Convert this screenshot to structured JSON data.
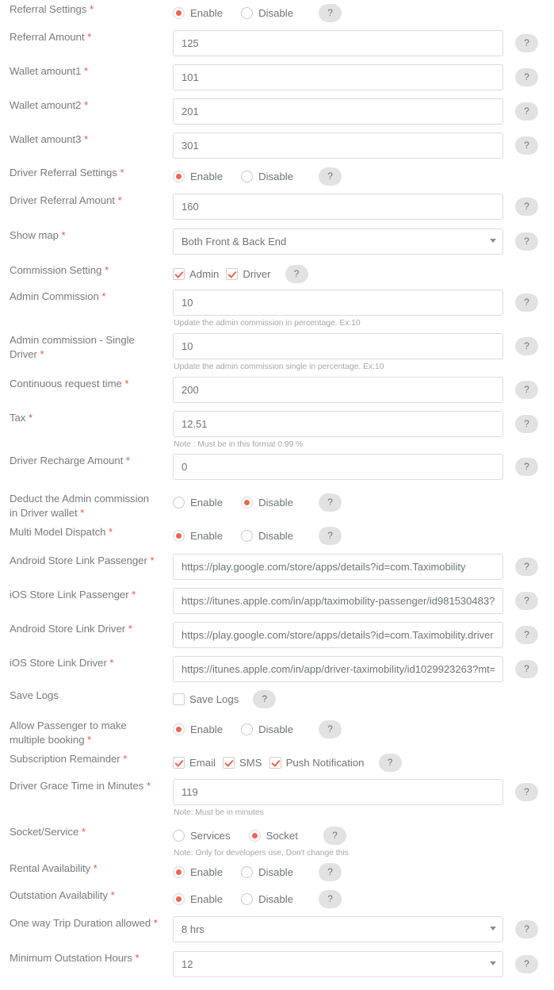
{
  "help_label": "?",
  "colors": {
    "accent": "#f4634e",
    "required": "#e8554d",
    "label_text": "#7b7b7b",
    "input_text": "#6e7478",
    "note_text": "#a8a8a8",
    "help_bg": "#e2e2e2",
    "border": "#dcdcdc"
  },
  "options": {
    "enable": "Enable",
    "disable": "Disable",
    "services": "Services",
    "socket": "Socket"
  },
  "rows": [
    {
      "id": "referral-settings",
      "label": "Referral Settings",
      "required": true,
      "type": "radio",
      "options": [
        "Enable",
        "Disable"
      ],
      "selected": "Enable"
    },
    {
      "id": "referral-amount",
      "label": "Referral Amount",
      "required": true,
      "type": "text",
      "value": "125"
    },
    {
      "id": "wallet-amount1",
      "label": "Wallet amount1",
      "required": true,
      "type": "text",
      "value": "101"
    },
    {
      "id": "wallet-amount2",
      "label": "Wallet amount2",
      "required": true,
      "type": "text",
      "value": "201"
    },
    {
      "id": "wallet-amount3",
      "label": "Wallet amount3",
      "required": true,
      "type": "text",
      "value": "301"
    },
    {
      "id": "driver-referral-settings",
      "label": "Driver Referral Settings",
      "required": true,
      "type": "radio",
      "options": [
        "Enable",
        "Disable"
      ],
      "selected": "Enable"
    },
    {
      "id": "driver-referral-amount",
      "label": "Driver Referral Amount",
      "required": true,
      "type": "text",
      "value": "160"
    },
    {
      "id": "show-map",
      "label": "Show map",
      "required": true,
      "type": "select",
      "value": "Both Front & Back End"
    },
    {
      "id": "commission-setting",
      "label": "Commission Setting",
      "required": true,
      "type": "checkbox",
      "options": [
        {
          "label": "Admin",
          "checked": true
        },
        {
          "label": "Driver",
          "checked": true
        }
      ]
    },
    {
      "id": "admin-commission",
      "label": "Admin Commission",
      "required": true,
      "type": "text",
      "value": "10",
      "note": "Update the admin commission in percentage. Ex:10"
    },
    {
      "id": "admin-commission-single-driver",
      "label": "Admin commission - Single Driver",
      "required": true,
      "type": "text",
      "value": "10",
      "note": "Update the admin commission single in percentage. Ex:10"
    },
    {
      "id": "continuous-request-time",
      "label": "Continuous request time",
      "required": true,
      "type": "text",
      "value": "200"
    },
    {
      "id": "tax",
      "label": "Tax",
      "required": true,
      "type": "text",
      "value": "12.51",
      "note": "Note : Must be in this format 0.99 %"
    },
    {
      "id": "driver-recharge-amount",
      "label": "Driver Recharge Amount",
      "required": true,
      "type": "text",
      "value": "0"
    },
    {
      "id": "deduct-admin-commission-driver-wallet",
      "label": "Deduct the Admin commission in Driver wallet",
      "required": true,
      "type": "radio",
      "options": [
        "Enable",
        "Disable"
      ],
      "selected": "Disable"
    },
    {
      "id": "multi-model-dispatch",
      "label": "Multi Model Dispatch",
      "required": true,
      "type": "radio",
      "options": [
        "Enable",
        "Disable"
      ],
      "selected": "Enable"
    },
    {
      "id": "android-store-link-passenger",
      "label": "Android Store Link Passenger",
      "required": true,
      "type": "text",
      "value": "https://play.google.com/store/apps/details?id=com.Taximobility"
    },
    {
      "id": "ios-store-link-passenger",
      "label": "iOS Store Link Passenger",
      "required": true,
      "type": "text",
      "value": "https://itunes.apple.com/in/app/taximobility-passenger/id981530483?"
    },
    {
      "id": "android-store-link-driver",
      "label": "Android Store Link Driver",
      "required": true,
      "type": "text",
      "value": "https://play.google.com/store/apps/details?id=com.Taximobility.driver"
    },
    {
      "id": "ios-store-link-driver",
      "label": "iOS Store Link Driver",
      "required": true,
      "type": "text",
      "value": "https://itunes.apple.com/in/app/driver-taximobility/id1029923263?mt="
    },
    {
      "id": "save-logs",
      "label": "Save Logs",
      "required": false,
      "type": "checkbox",
      "options": [
        {
          "label": "Save Logs",
          "checked": false
        }
      ]
    },
    {
      "id": "allow-passenger-multiple-booking",
      "label": "Allow Passenger to make multiple booking",
      "required": true,
      "type": "radio",
      "options": [
        "Enable",
        "Disable"
      ],
      "selected": "Enable"
    },
    {
      "id": "subscription-remainder",
      "label": "Subscription Remainder",
      "required": true,
      "type": "checkbox",
      "options": [
        {
          "label": "Email",
          "checked": true
        },
        {
          "label": "SMS",
          "checked": true
        },
        {
          "label": "Push Notification",
          "checked": true
        }
      ]
    },
    {
      "id": "driver-grace-time-minutes",
      "label": "Driver Grace Time in Minutes",
      "required": true,
      "type": "text",
      "value": "119",
      "note": "Note: Must be in minutes"
    },
    {
      "id": "socket-service",
      "label": "Socket/Service",
      "required": true,
      "type": "radio",
      "options": [
        "Services",
        "Socket"
      ],
      "selected": "Socket",
      "note": "Note: Only for developers use, Don't change this"
    },
    {
      "id": "rental-availability",
      "label": "Rental Availability",
      "required": true,
      "type": "radio",
      "options": [
        "Enable",
        "Disable"
      ],
      "selected": "Enable"
    },
    {
      "id": "outstation-availability",
      "label": "Outstation Availability",
      "required": true,
      "type": "radio",
      "options": [
        "Enable",
        "Disable"
      ],
      "selected": "Enable"
    },
    {
      "id": "one-way-trip-duration-allowed",
      "label": "One way Trip Duration allowed",
      "required": true,
      "type": "select",
      "value": "8 hrs"
    },
    {
      "id": "minimum-outstation-hours",
      "label": "Minimum Outstation Hours",
      "required": true,
      "type": "select",
      "value": "12"
    }
  ]
}
